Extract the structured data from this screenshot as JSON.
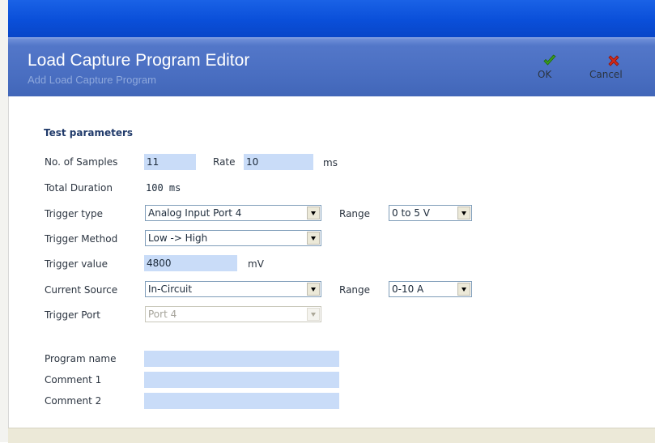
{
  "window": {
    "title": "Load Capture Program Editor",
    "subtitle": "Add Load Capture Program"
  },
  "actions": {
    "ok_label": "OK",
    "cancel_label": "Cancel",
    "ok_color": "#3a9a1e",
    "cancel_color": "#d42a1a"
  },
  "form": {
    "section_title": "Test parameters",
    "samples": {
      "label": "No. of Samples",
      "value": "11"
    },
    "rate": {
      "label": "Rate",
      "value": "10",
      "unit": "ms"
    },
    "total_duration": {
      "label": "Total Duration",
      "value": "100 ms"
    },
    "trigger_type": {
      "label": "Trigger type",
      "value": "Analog Input Port 4"
    },
    "trigger_range": {
      "label": "Range",
      "value": "0 to 5 V"
    },
    "trigger_method": {
      "label": "Trigger Method",
      "value": "Low -> High"
    },
    "trigger_value": {
      "label": "Trigger value",
      "value": "4800",
      "unit": "mV"
    },
    "current_source": {
      "label": "Current Source",
      "value": "In-Circuit"
    },
    "current_range": {
      "label": "Range",
      "value": "0-10 A"
    },
    "trigger_port": {
      "label": "Trigger Port",
      "value": "Port 4"
    },
    "program_name": {
      "label": "Program name",
      "value": ""
    },
    "comment1": {
      "label": "Comment 1",
      "value": ""
    },
    "comment2": {
      "label": "Comment 2",
      "value": ""
    }
  }
}
